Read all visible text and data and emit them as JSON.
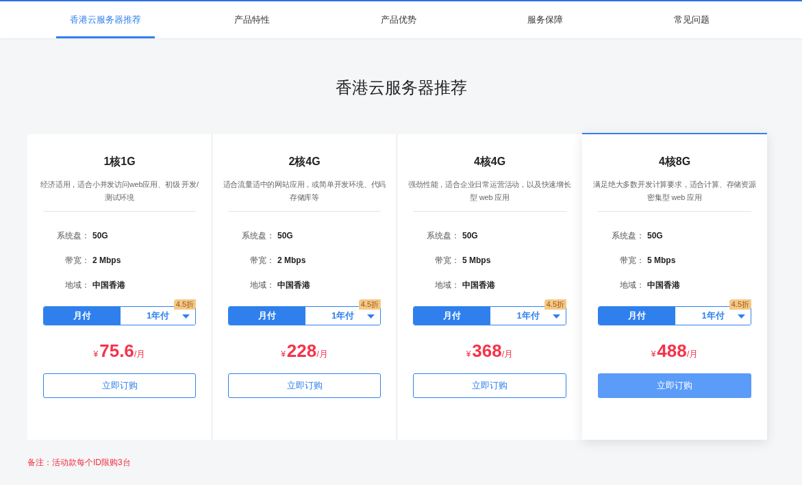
{
  "nav": {
    "tabs": [
      {
        "label": "香港云服务器推荐",
        "selected": true
      },
      {
        "label": "产品特性",
        "selected": false
      },
      {
        "label": "产品优势",
        "selected": false
      },
      {
        "label": "服务保障",
        "selected": false
      },
      {
        "label": "常见问题",
        "selected": false
      }
    ]
  },
  "section_title": "香港云服务器推荐",
  "plans": [
    {
      "name": "1核1G",
      "description": "经济适用，适合小并发访问web应用、初级 开发/测试环境",
      "specs": [
        {
          "label": "系统盘：",
          "value": "50G"
        },
        {
          "label": "带宽：",
          "value": "2 Mbps"
        },
        {
          "label": "地域：",
          "value": "中国香港"
        }
      ],
      "billing": [
        {
          "label": "月付",
          "selected": true
        },
        {
          "label": "1年付",
          "selected": false
        }
      ],
      "discount": "4.5折",
      "currency": "¥",
      "price": "75.6",
      "unit": "/月",
      "button": "立即订购",
      "selected": false
    },
    {
      "name": "2核4G",
      "description": "适合流量适中的网站应用，或简单开发环境、代码存储库等",
      "specs": [
        {
          "label": "系统盘：",
          "value": "50G"
        },
        {
          "label": "带宽：",
          "value": "2 Mbps"
        },
        {
          "label": "地域：",
          "value": "中国香港"
        }
      ],
      "billing": [
        {
          "label": "月付",
          "selected": true
        },
        {
          "label": "1年付",
          "selected": false
        }
      ],
      "discount": "4.5折",
      "currency": "¥",
      "price": "228",
      "unit": "/月",
      "button": "立即订购",
      "selected": false
    },
    {
      "name": "4核4G",
      "description": "强劲性能，适合企业日常运营活动，以及快速增长型 web 应用",
      "specs": [
        {
          "label": "系统盘：",
          "value": "50G"
        },
        {
          "label": "带宽：",
          "value": "5 Mbps"
        },
        {
          "label": "地域：",
          "value": "中国香港"
        }
      ],
      "billing": [
        {
          "label": "月付",
          "selected": true
        },
        {
          "label": "1年付",
          "selected": false
        }
      ],
      "discount": "4.5折",
      "currency": "¥",
      "price": "368",
      "unit": "/月",
      "button": "立即订购",
      "selected": false
    },
    {
      "name": "4核8G",
      "description": "满足绝大多数开发计算要求，适合计算、存储资源密集型 web 应用",
      "specs": [
        {
          "label": "系统盘：",
          "value": "50G"
        },
        {
          "label": "带宽：",
          "value": "5 Mbps"
        },
        {
          "label": "地域：",
          "value": "中国香港"
        }
      ],
      "billing": [
        {
          "label": "月付",
          "selected": true
        },
        {
          "label": "1年付",
          "selected": false
        }
      ],
      "discount": "4.5折",
      "currency": "¥",
      "price": "488",
      "unit": "/月",
      "button": "立即订购",
      "selected": true
    }
  ],
  "note": "备注：活动款每个ID限购3台"
}
